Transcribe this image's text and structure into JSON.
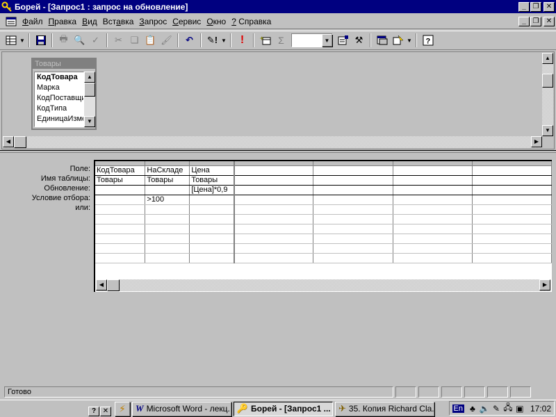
{
  "window": {
    "title": "Борей - [Запрос1 : запрос на обновление]"
  },
  "menu": {
    "items": [
      {
        "pre": "",
        "key": "Ф",
        "post": "айл"
      },
      {
        "pre": "",
        "key": "П",
        "post": "равка"
      },
      {
        "pre": "",
        "key": "В",
        "post": "ид"
      },
      {
        "pre": "Вст",
        "key": "а",
        "post": "вка"
      },
      {
        "pre": "",
        "key": "З",
        "post": "апрос"
      },
      {
        "pre": "",
        "key": "С",
        "post": "ервис"
      },
      {
        "pre": "",
        "key": "О",
        "post": "кно"
      },
      {
        "pre": "",
        "key": "?",
        "post": " Справка"
      }
    ]
  },
  "table_box": {
    "caption": "Товары",
    "fields": [
      "КодТовара",
      "Марка",
      "КодПоставщика",
      "КодТипа",
      "ЕдиницаИзмерения"
    ]
  },
  "grid": {
    "row_labels": [
      "Поле:",
      "Имя таблицы:",
      "Обновление:",
      "Условие отбора:",
      "или:"
    ],
    "columns": [
      {
        "field": "КодТовара",
        "table": "Товары",
        "update": "",
        "criteria": "",
        "or": ""
      },
      {
        "field": "НаСкладе",
        "table": "Товары",
        "update": "",
        "criteria": ">100",
        "or": ""
      },
      {
        "field": "Цена",
        "table": "Товары",
        "update": "[Цена]*0,9",
        "criteria": "",
        "or": ""
      }
    ]
  },
  "status": {
    "message": "Готово"
  },
  "taskbar": {
    "tasks": [
      {
        "label": "Microsoft Word - лекц..."
      },
      {
        "label": "Борей - [Запрос1 ..."
      },
      {
        "label": "35. Копия Richard Cla..."
      }
    ],
    "lang": "En",
    "clock": "17:02"
  }
}
